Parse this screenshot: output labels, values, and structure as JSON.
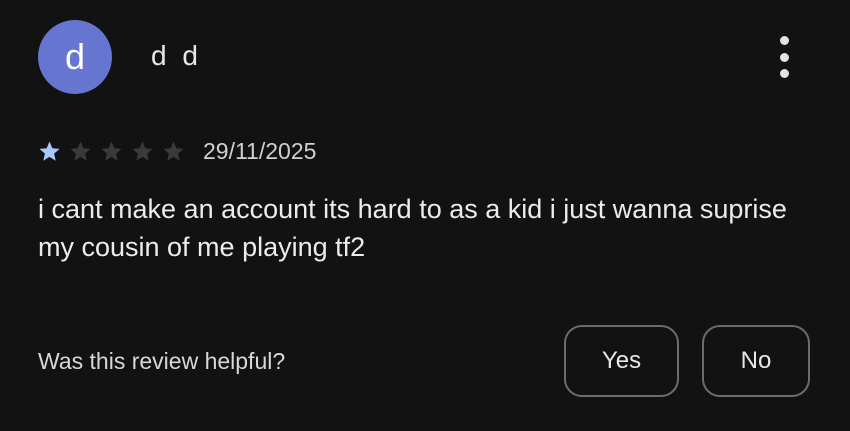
{
  "reviewer": {
    "avatar_letter": "d",
    "avatar_color": "#6675cf",
    "name": "d d"
  },
  "menu": {
    "icon": "more-vert-icon"
  },
  "rating": {
    "stars_filled": 1,
    "stars_total": 5,
    "filled_color": "#a8c7fa",
    "empty_color": "#3a3a3a",
    "date": "29/11/2025"
  },
  "review": {
    "text": "i cant make an account its hard to as a kid i just wanna suprise my cousin of me playing tf2"
  },
  "feedback": {
    "question": "Was this review helpful?",
    "yes_label": "Yes",
    "no_label": "No"
  }
}
